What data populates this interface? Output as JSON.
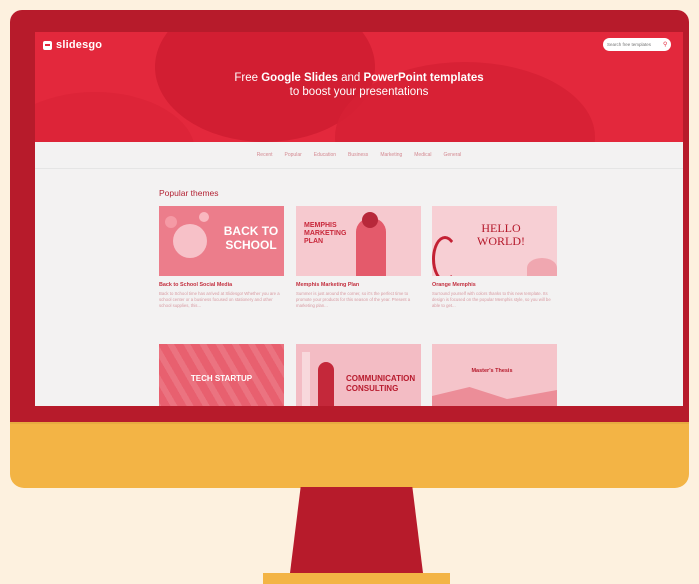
{
  "site": {
    "logo": "slidesgo",
    "search_placeholder": "Search free templates",
    "hero_line1_a": "Free ",
    "hero_line1_b": "Google Slides",
    "hero_line1_c": " and ",
    "hero_line1_d": "PowerPoint templates",
    "hero_line2": "to boost your presentations"
  },
  "nav": [
    "Recent",
    "Popular",
    "Education",
    "Business",
    "Marketing",
    "Medical",
    "General"
  ],
  "section_title": "Popular themes",
  "cards": [
    {
      "title": "Back to School Social Media",
      "desc": "Back to School time has arrived at Slidesgo! Whether you are a school center or a business focused on stationery and other school supplies, this...",
      "thumb_line1": "BACK TO",
      "thumb_line2": "SCHOOL"
    },
    {
      "title": "Memphis Marketing Plan",
      "desc": "Summer is just around the corner, so it's the perfect time to promote your products for this season of the year. Present a marketing plan...",
      "thumb_line1": "MEMPHIS",
      "thumb_line2": "MARKETING",
      "thumb_line3": "PLAN"
    },
    {
      "title": "Orange Memphis",
      "desc": "Surround yourself with colors thanks to this new template. Its design is focused on the popular Memphis style, so you will be able to get...",
      "thumb_line1": "HELLO",
      "thumb_line2": "WORLD!"
    },
    {
      "thumb_line1": "TECH STARTUP"
    },
    {
      "thumb_line1": "COMMUNICATION",
      "thumb_line2": "CONSULTING"
    },
    {
      "thumb_line1": "Master's Thesis"
    }
  ],
  "colors": {
    "bezel": "#b71b2b",
    "chin": "#f3b445",
    "background": "#fdf1df",
    "hero": "#e3283c"
  }
}
